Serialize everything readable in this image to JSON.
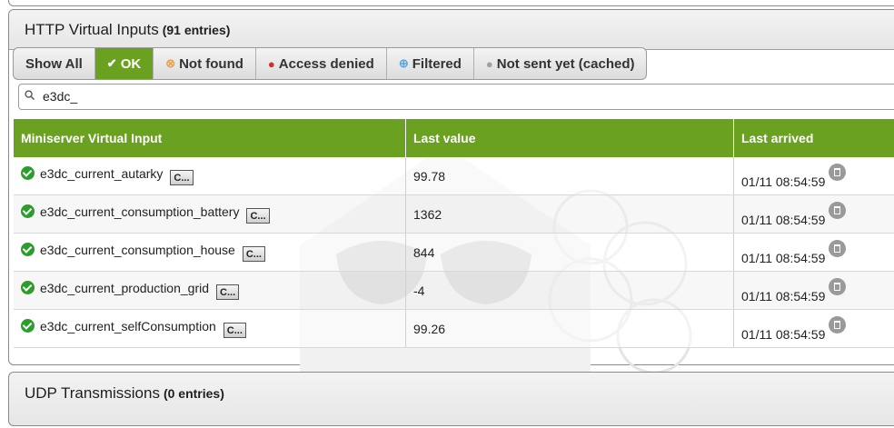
{
  "http_panel": {
    "title": "HTTP Virtual Inputs",
    "count": "(91 entries)",
    "filters": [
      {
        "label": "Show All",
        "icon": "",
        "active": false
      },
      {
        "label": "OK",
        "icon": "check-icon",
        "active": true
      },
      {
        "label": "Not found",
        "icon": "not-found-icon",
        "active": false
      },
      {
        "label": "Access denied",
        "icon": "lock-icon",
        "active": false
      },
      {
        "label": "Filtered",
        "icon": "filter-icon",
        "active": false
      },
      {
        "label": "Not sent yet (cached)",
        "icon": "question-icon",
        "active": false
      }
    ],
    "search": {
      "value": "e3dc_"
    },
    "columns": [
      "Miniserver Virtual Input",
      "Last value",
      "Last arrived"
    ],
    "rows": [
      {
        "name": "e3dc_current_autarky",
        "btn": "C...",
        "value": "99.78",
        "arrived": "01/11 08:54:59"
      },
      {
        "name": "e3dc_current_consumption_battery",
        "btn": "C...",
        "value": "1362",
        "arrived": "01/11 08:54:59"
      },
      {
        "name": "e3dc_current_consumption_house",
        "btn": "C...",
        "value": "844",
        "arrived": "01/11 08:54:59"
      },
      {
        "name": "e3dc_current_production_grid",
        "btn": "C...",
        "value": "-4",
        "arrived": "01/11 08:54:59"
      },
      {
        "name": "e3dc_current_selfConsumption",
        "btn": "C...",
        "value": "99.26",
        "arrived": "01/11 08:54:59"
      }
    ]
  },
  "udp_panel": {
    "title": "UDP Transmissions",
    "count": "(0 entries)"
  },
  "colors": {
    "accent": "#6aa121",
    "ok": "#2a9d2a"
  }
}
